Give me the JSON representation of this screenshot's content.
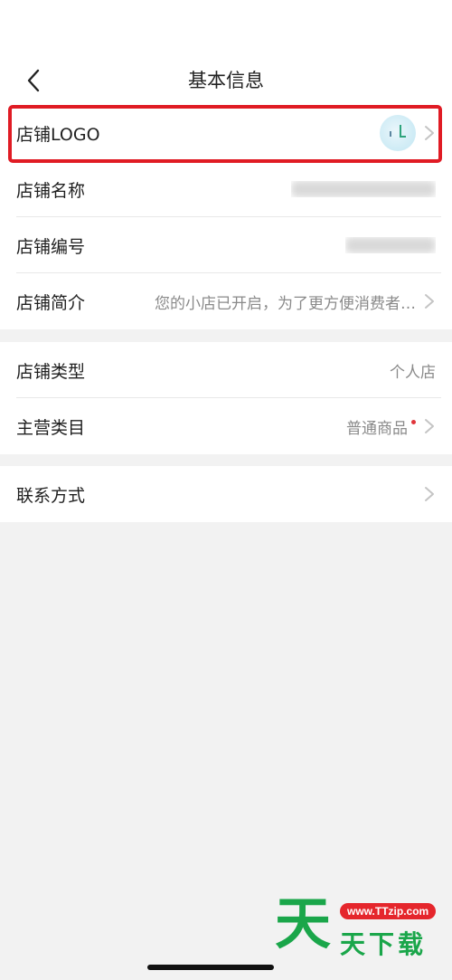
{
  "header": {
    "title": "基本信息"
  },
  "group1": {
    "logo": {
      "label": "店铺LOGO"
    },
    "name": {
      "label": "店铺名称"
    },
    "number": {
      "label": "店铺编号"
    },
    "intro": {
      "label": "店铺简介",
      "value": "您的小店已开启，为了更方便消费者…"
    }
  },
  "group2": {
    "type": {
      "label": "店铺类型",
      "value": "个人店"
    },
    "category": {
      "label": "主营类目",
      "value": "普通商品"
    }
  },
  "group3": {
    "contact": {
      "label": "联系方式"
    }
  },
  "watermark": {
    "big": "天",
    "site": "www.TTzip.com",
    "small": "天下载"
  },
  "colors": {
    "highlight": "#e01b24",
    "background": "#f2f2f2",
    "secondary_text": "#8a8a8a"
  }
}
